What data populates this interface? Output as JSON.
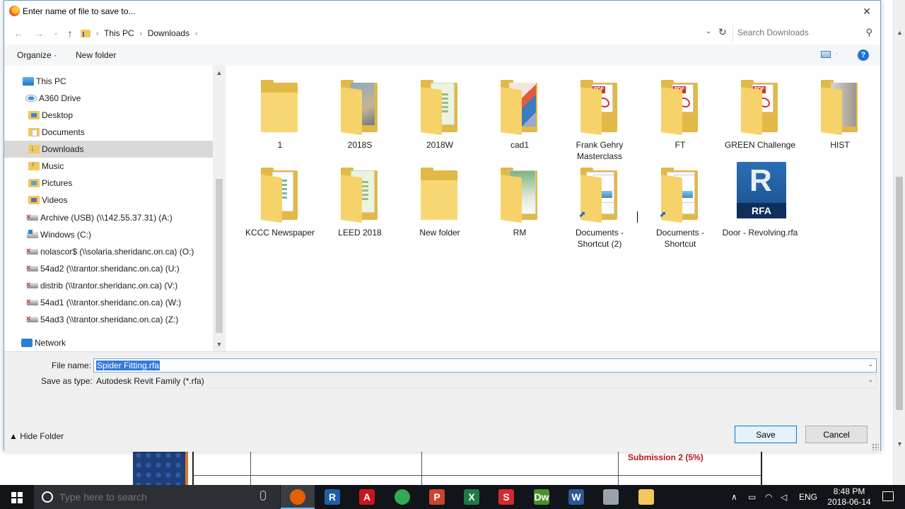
{
  "background": {
    "submission_text": "Submission 2 (5%)"
  },
  "dialog": {
    "title": "Enter name of file to save to...",
    "close_glyph": "✕",
    "address": {
      "back_glyph": "←",
      "forward_glyph": "→",
      "recent_glyph": "⌄",
      "up_glyph": "↑",
      "breadcrumb": [
        "This PC",
        "Downloads"
      ],
      "separator": "›",
      "dropdown_glyph": "⌄",
      "refresh_glyph": "↻",
      "search_placeholder": "Search Downloads",
      "search_glyph": "⚲"
    },
    "toolbar": {
      "organize_label": "Organize ·",
      "new_folder_label": "New folder",
      "view_dd_glyph": "·",
      "help_glyph": "?"
    },
    "nav": {
      "up_glyph": "▲",
      "down_glyph": "▼",
      "items": [
        {
          "label": "This PC",
          "icon": "computer-icon"
        },
        {
          "label": "A360 Drive",
          "icon": "cloud-drive-icon"
        },
        {
          "label": "Desktop",
          "icon": "desktop-folder-icon"
        },
        {
          "label": "Documents",
          "icon": "documents-folder-icon"
        },
        {
          "label": "Downloads",
          "icon": "downloads-folder-icon",
          "selected": true
        },
        {
          "label": "Music",
          "icon": "music-folder-icon"
        },
        {
          "label": "Pictures",
          "icon": "pictures-folder-icon"
        },
        {
          "label": "Videos",
          "icon": "videos-folder-icon"
        },
        {
          "label": "Archive (USB) (\\\\142.55.37.31) (A:)",
          "icon": "disconnected-drive-icon"
        },
        {
          "label": "Windows (C:)",
          "icon": "windows-drive-icon"
        },
        {
          "label": "nolascor$ (\\\\solaria.sheridanc.on.ca) (O:)",
          "icon": "disconnected-drive-icon"
        },
        {
          "label": "54ad2 (\\\\trantor.sheridanc.on.ca) (U:)",
          "icon": "disconnected-drive-icon"
        },
        {
          "label": "distrib (\\\\trantor.sheridanc.on.ca) (V:)",
          "icon": "disconnected-drive-icon"
        },
        {
          "label": "54ad1 (\\\\trantor.sheridanc.on.ca) (W:)",
          "icon": "disconnected-drive-icon"
        },
        {
          "label": "54ad3 (\\\\trantor.sheridanc.on.ca) (Z:)",
          "icon": "disconnected-drive-icon"
        },
        {
          "label": "Network",
          "icon": "network-icon"
        }
      ]
    },
    "files": [
      {
        "name": "1",
        "kind": "folder-empty"
      },
      {
        "name": "2018S",
        "kind": "folder-photo"
      },
      {
        "name": "2018W",
        "kind": "folder-doc"
      },
      {
        "name": "cad1",
        "kind": "folder-cad"
      },
      {
        "name": "Frank Gehry Masterclass",
        "kind": "folder-pdf"
      },
      {
        "name": "FT",
        "kind": "folder-pdf"
      },
      {
        "name": "GREEN Challenge",
        "kind": "folder-pdf"
      },
      {
        "name": "HIST",
        "kind": "folder-hist"
      },
      {
        "name": "KCCC Newspaper",
        "kind": "folder-paper"
      },
      {
        "name": "LEED 2018",
        "kind": "folder-doc"
      },
      {
        "name": "New folder",
        "kind": "folder-empty"
      },
      {
        "name": "RM",
        "kind": "folder-rm"
      },
      {
        "name": "Documents - Shortcut (2)",
        "kind": "shortcut-word"
      },
      {
        "name": "Documents - Shortcut",
        "kind": "shortcut-word"
      },
      {
        "name": "Door - Revolving.rfa",
        "kind": "rfa-file",
        "icon_letter": "R",
        "icon_label": "RFA"
      }
    ],
    "form": {
      "file_name_label": "File name:",
      "file_name_value": "Spider Fitting.rfa",
      "save_type_label": "Save as type:",
      "save_type_value": "Autodesk Revit Family (*.rfa)",
      "dropdown_glyph": "⌄",
      "hide_folder_label": "▲ Hide Folder",
      "save_label": "Save",
      "cancel_label": "Cancel"
    }
  },
  "taskbar": {
    "search_placeholder": "Type here to search",
    "apps": [
      {
        "name": "firefox",
        "glyph": "",
        "color": "#e66000"
      },
      {
        "name": "revit",
        "glyph": "R",
        "color": "#1f5fa8"
      },
      {
        "name": "autocad",
        "glyph": "A",
        "color": "#c8161e"
      },
      {
        "name": "chrome-globe",
        "glyph": "",
        "color": "#34a853"
      },
      {
        "name": "powerpoint",
        "glyph": "P",
        "color": "#c8462c"
      },
      {
        "name": "excel",
        "glyph": "X",
        "color": "#1e7b45"
      },
      {
        "name": "sketchup",
        "glyph": "S",
        "color": "#d6282b"
      },
      {
        "name": "dreamweaver",
        "glyph": "Dw",
        "color": "#4a8f2a"
      },
      {
        "name": "word",
        "glyph": "W",
        "color": "#2b5797"
      },
      {
        "name": "paint-tool",
        "glyph": "",
        "color": "#9aa3ad"
      },
      {
        "name": "file-explorer",
        "glyph": "",
        "color": "#f3c85b"
      }
    ],
    "tray": {
      "chevron": "∧",
      "lang": "ENG",
      "time": "8:48 PM",
      "date": "2018-06-14"
    }
  }
}
